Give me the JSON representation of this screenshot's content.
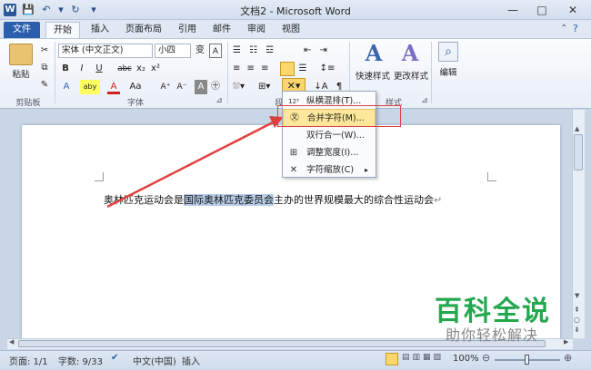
{
  "window": {
    "title": "文档2 - Microsoft Word",
    "logo": "W"
  },
  "qat": {
    "save": "💾",
    "undo": "↶",
    "undo_drop": "▾",
    "redo": "↻",
    "customize": "▾"
  },
  "winbtns": {
    "minimize": "—",
    "maximize": "□",
    "close": "✕"
  },
  "tabs": [
    {
      "label": "文件"
    },
    {
      "label": "开始"
    },
    {
      "label": "插入"
    },
    {
      "label": "页面布局"
    },
    {
      "label": "引用"
    },
    {
      "label": "邮件"
    },
    {
      "label": "审阅"
    },
    {
      "label": "视图"
    }
  ],
  "ribbon": {
    "clipboard": {
      "paste": "粘贴",
      "group": "剪贴板",
      "cut": "✂",
      "copy": "⧉",
      "painter": "✎"
    },
    "font": {
      "name": "宋体 (中文正文)",
      "size": "小四",
      "wen": "变",
      "a_sym": "A",
      "bold": "B",
      "italic": "I",
      "underline": "U",
      "strike": "abc",
      "sub": "x₂",
      "sup": "x²",
      "grow": "A⁺",
      "shrink": "A⁻",
      "clear": "A",
      "circle": "㊉",
      "highlight": "aby",
      "fontcolor": "A",
      "case": "Aa",
      "effects": "A",
      "group": "字体",
      "launcher": "⊿"
    },
    "paragraph": {
      "group": "段",
      "launcher": "⊿"
    },
    "styles": {
      "quick": "快速样式",
      "change": "更改样式",
      "group": "样式",
      "icon_a": "A",
      "launcher": "⊿"
    },
    "edit": {
      "label": "编辑",
      "icon": "⌕"
    }
  },
  "menu": {
    "items": [
      {
        "label": "纵横混排(T)...",
        "icon": "12³"
      },
      {
        "label": "合并字符(M)...",
        "icon": "㉆"
      },
      {
        "label": "双行合一(W)...",
        "icon": ""
      },
      {
        "label": "调整宽度(I)...",
        "icon": "⊞"
      },
      {
        "label": "字符缩放(C)",
        "icon": "✕",
        "arrow": "▸"
      }
    ]
  },
  "document": {
    "before": "奥林匹克运动会是",
    "highlight": "国际奥林匹克委员会",
    "after": "主办的世界规模最大的综合性运动会",
    "mark": "↵"
  },
  "status": {
    "page": "页面: 1/1",
    "words": "字数: 9/33",
    "lang": "中文(中国)",
    "mode": "插入",
    "zoom": "100%",
    "zoom_out": "⊖",
    "zoom_in": "⊕"
  },
  "watermark": {
    "line1": "百科全说",
    "line2": "助你轻松解决"
  },
  "colors": {
    "accent": "#2b5fad",
    "highlight": "#b8cde9",
    "menu_sel": "#fde79a",
    "callout": "#e04040",
    "watermark": "#23a74f"
  }
}
